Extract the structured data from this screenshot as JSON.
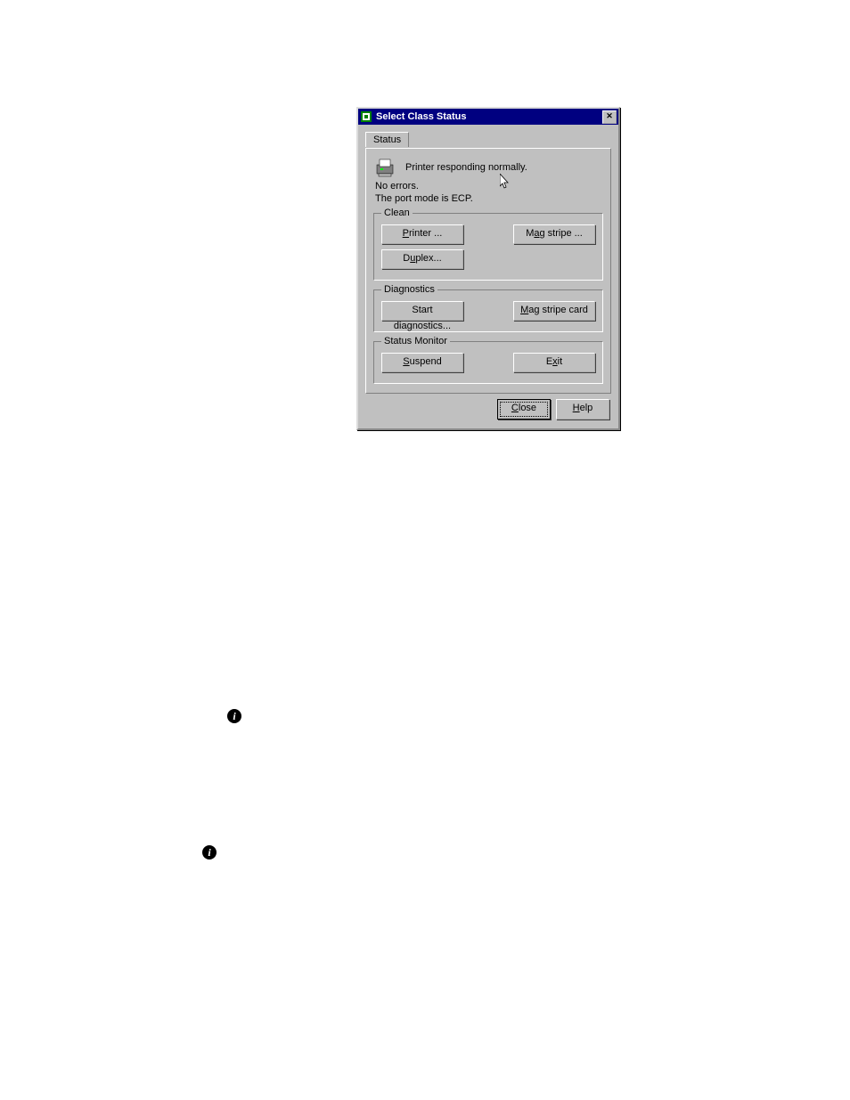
{
  "dialog": {
    "title": "Select Class Status",
    "tab_label": "Status",
    "status_line": "Printer responding normally.",
    "errors_line": "No errors.",
    "port_line": "The port mode is ECP.",
    "groups": {
      "clean": {
        "legend": "Clean",
        "printer_btn": "Printer ...",
        "magstripe_btn": "Mag stripe ...",
        "duplex_btn": "Duplex..."
      },
      "diagnostics": {
        "legend": "Diagnostics",
        "start_btn": "Start diagnostics...",
        "card_btn": "Mag stripe card"
      },
      "monitor": {
        "legend": "Status Monitor",
        "suspend_btn": "Suspend",
        "exit_btn": "Exit"
      }
    },
    "footer": {
      "close": "Close",
      "help": "Help"
    }
  },
  "info_char": "i"
}
